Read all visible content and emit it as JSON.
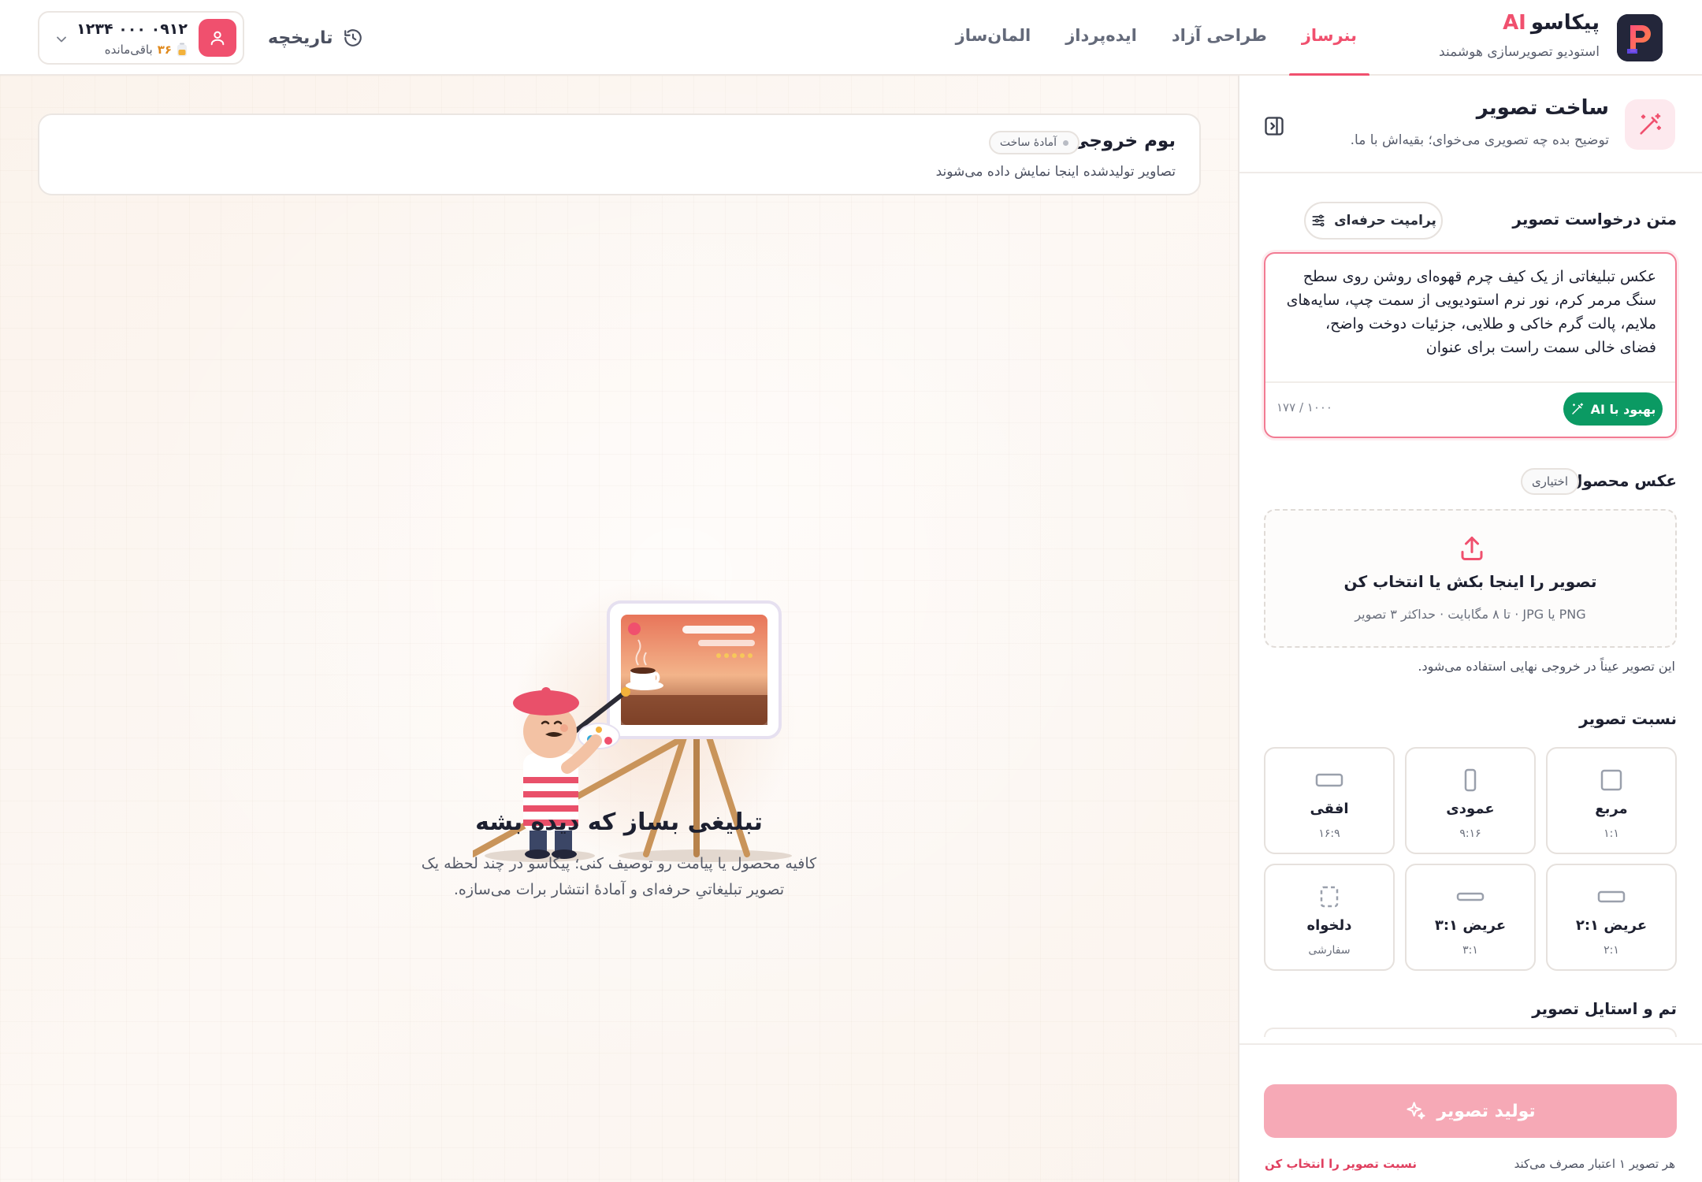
{
  "app": {
    "brand_name": "پیکاسو",
    "brand_ai": "AI",
    "brand_subtitle": "استودیو تصویرسازی هوشمند"
  },
  "nav": {
    "tabs": [
      {
        "label": "بنرساز",
        "active": true
      },
      {
        "label": "طراحی آزاد",
        "active": false
      },
      {
        "label": "ایده‌پرداز",
        "active": false
      },
      {
        "label": "المان‌ساز",
        "active": false
      }
    ]
  },
  "history": {
    "label": "تاریخچه",
    "icon": "history-icon"
  },
  "account": {
    "phone": "۰۹۱۲ ۰۰۰ ۱۲۳۴",
    "credits_number": "۳۶",
    "credits_label": "باقی‌مانده",
    "icons": [
      "user-icon",
      "battery-icon",
      "chevron-down-icon"
    ]
  },
  "sidebar": {
    "title": "ساخت تصویر",
    "subtitle": "توضیح بده چه تصویری می‌خوای؛ بقیه‌اش با ما.",
    "prompt_label": "متن درخواست تصویر",
    "pro_prompt_button": "پرامپت حرفه‌ای",
    "prompt_value": "عکس تبلیغاتی از یک کیف چرم قهوه‌ای روشن روی سطح سنگ مرمر کرم، نور نرم استودیویی از سمت چپ، سایه‌های ملایم، پالت گرم خاکی و طلایی، جزئیات دوخت واضح، فضای خالی سمت راست برای عنوان",
    "char_count": "۱۰۰۰ / ۱۷۷",
    "improve_button": "بهبود با AI",
    "product_photo_label": "عکس محصول",
    "optional_badge": "اختیاری",
    "upload_title": "تصویر را اینجا بکش یا انتخاب کن",
    "upload_sub": "PNG یا JPG · تا ۸ مگابایت · حداکثر ۳ تصویر",
    "upload_note": "این تصویر عیناً در خروجی نهایی استفاده می‌شود.",
    "ratio_label": "نسبت تصویر",
    "ratios": [
      {
        "name": "مربع",
        "value": "۱:۱",
        "icon": "square-icon"
      },
      {
        "name": "عمودی",
        "value": "۹:۱۶",
        "icon": "portrait-icon"
      },
      {
        "name": "افقی",
        "value": "۱۶:۹",
        "icon": "landscape-icon"
      },
      {
        "name": "عریض ۲:۱",
        "value": "۲:۱",
        "icon": "wide-icon"
      },
      {
        "name": "عریض ۳:۱",
        "value": "۳:۱",
        "icon": "ultrawide-icon"
      },
      {
        "name": "دلخواه",
        "value": "سفارشی",
        "icon": "custom-ratio-icon"
      }
    ],
    "theme_label": "تم و استایل تصویر",
    "generate_button": "تولید تصویر",
    "cost_note": "هر تصویر ۱ اعتبار مصرف می‌کند",
    "warn_note": "نسبت تصویر را انتخاب کن"
  },
  "output": {
    "title": "بوم خروجی",
    "badge": "آمادهٔ ساخت",
    "subtitle": "تصاویر تولیدشده اینجا نمایش داده می‌شوند",
    "empty_title": "تبلیغی بساز که دیده بشه",
    "empty_line1": "کافیه محصول یا پیامت رو توصیف کنی؛ پیکاسو در چند لحظه یک",
    "empty_line2": "تصویر تبلیغاتیِ حرفه‌ای و آمادهٔ انتشار برات می‌سازه."
  },
  "colors": {
    "accent": "#f0506e",
    "success": "#0b9a63",
    "disabled_accent": "#f6a9b6",
    "credits": "#e08a1e"
  }
}
